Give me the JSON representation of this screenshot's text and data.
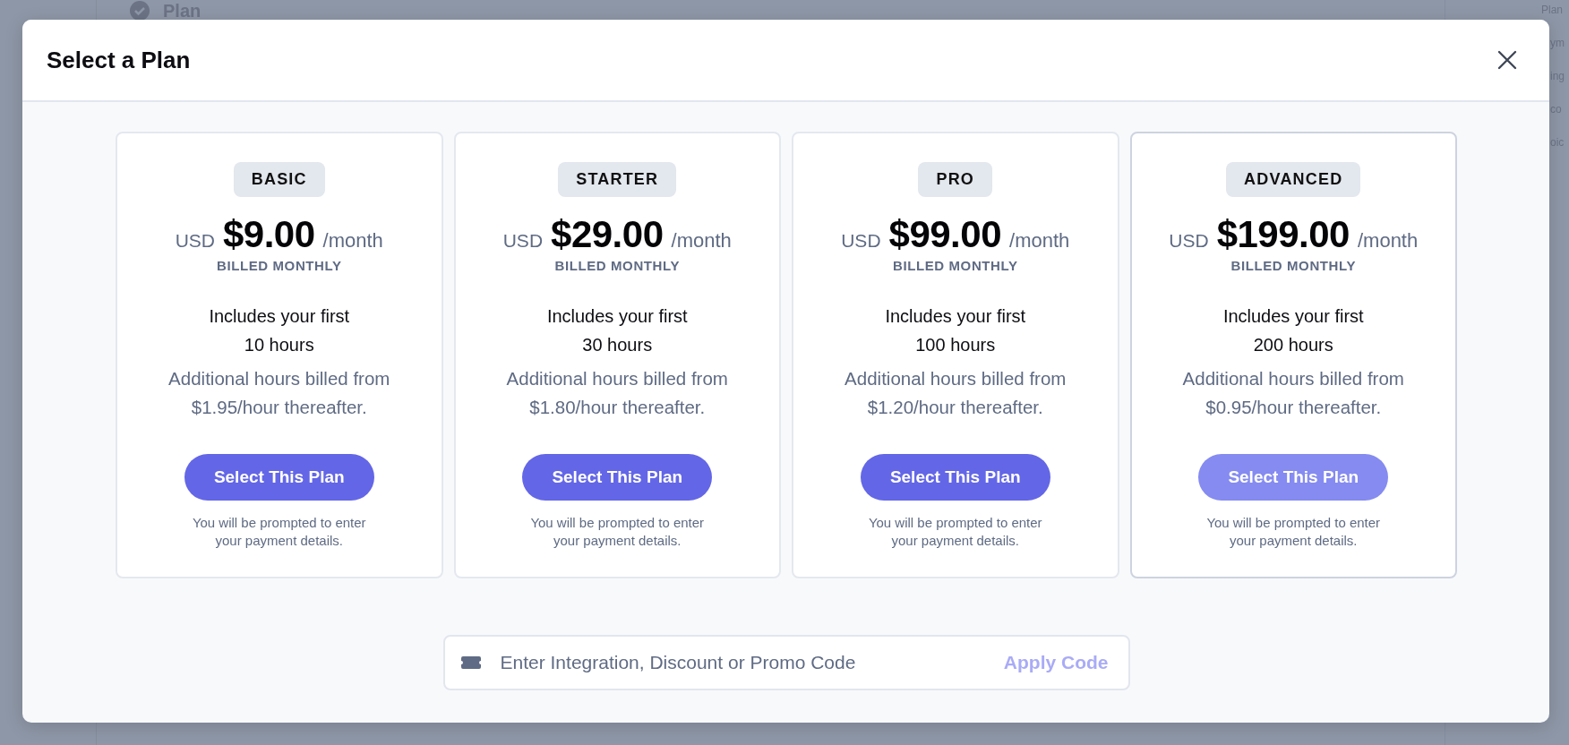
{
  "background": {
    "page_title": "Plan",
    "sidebar_fragments": [
      "Plan",
      "ym",
      "ing",
      "co",
      "oic"
    ]
  },
  "dialog": {
    "title": "Select a Plan"
  },
  "plans": [
    {
      "name": "BASIC",
      "currency": "USD",
      "price": "$9.00",
      "period": "/month",
      "billing": "BILLED MONTHLY",
      "includes": [
        "Includes your first",
        "10 hours"
      ],
      "additional": [
        "Additional hours billed from",
        "$1.95/hour thereafter."
      ],
      "button": "Select This Plan",
      "note": [
        "You will be prompted to enter",
        "your payment details."
      ],
      "selected": false
    },
    {
      "name": "STARTER",
      "currency": "USD",
      "price": "$29.00",
      "period": "/month",
      "billing": "BILLED MONTHLY",
      "includes": [
        "Includes your first",
        "30 hours"
      ],
      "additional": [
        "Additional hours billed from",
        "$1.80/hour thereafter."
      ],
      "button": "Select This Plan",
      "note": [
        "You will be prompted to enter",
        "your payment details."
      ],
      "selected": false
    },
    {
      "name": "PRO",
      "currency": "USD",
      "price": "$99.00",
      "period": "/month",
      "billing": "BILLED MONTHLY",
      "includes": [
        "Includes your first",
        "100 hours"
      ],
      "additional": [
        "Additional hours billed from",
        "$1.20/hour thereafter."
      ],
      "button": "Select This Plan",
      "note": [
        "You will be prompted to enter",
        "your payment details."
      ],
      "selected": false
    },
    {
      "name": "ADVANCED",
      "currency": "USD",
      "price": "$199.00",
      "period": "/month",
      "billing": "BILLED MONTHLY",
      "includes": [
        "Includes your first",
        "200 hours"
      ],
      "additional": [
        "Additional hours billed from",
        "$0.95/hour thereafter."
      ],
      "button": "Select This Plan",
      "note": [
        "You will be prompted to enter",
        "your payment details."
      ],
      "selected": true
    }
  ],
  "promo": {
    "placeholder": "Enter Integration, Discount or Promo Code",
    "button": "Apply Code"
  }
}
